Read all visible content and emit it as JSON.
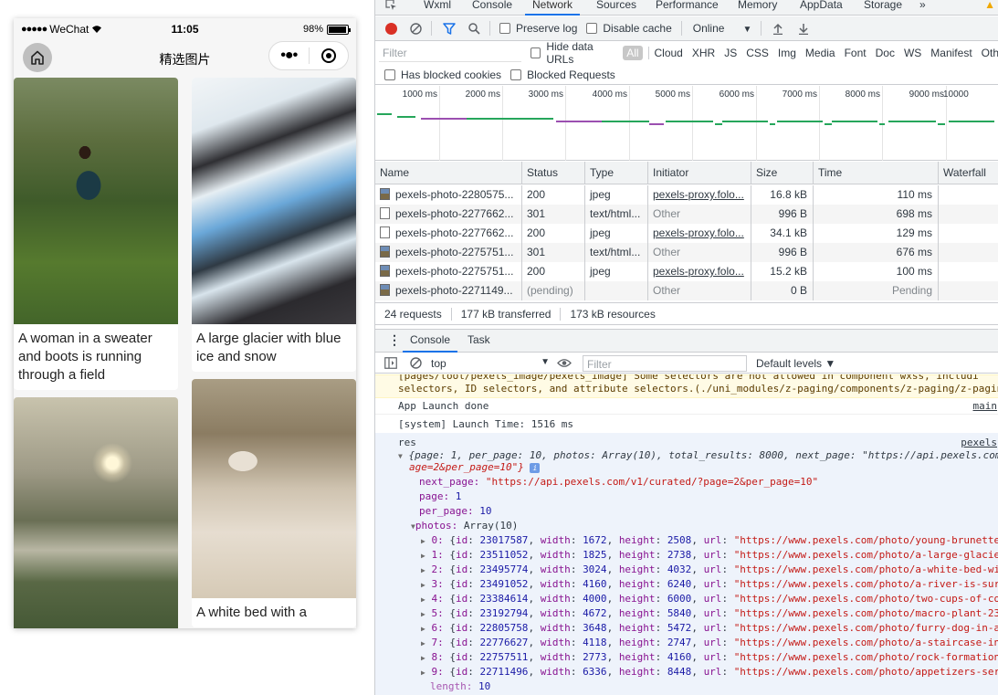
{
  "phone": {
    "status": {
      "carrier": "WeChat",
      "time": "11:05",
      "battery_text": "98%",
      "battery_level": 0.98
    },
    "nav": {
      "title": "精选图片"
    },
    "cards": [
      {
        "caption": "A woman in a sweater and boots is running through a field"
      },
      {
        "caption": "A large glacier with blue ice and snow"
      },
      {
        "caption": ""
      },
      {
        "caption": "A white bed with a"
      }
    ]
  },
  "devtools": {
    "tabs": [
      "Wxml",
      "Console",
      "Network",
      "Sources",
      "Performance",
      "Memory",
      "AppData",
      "Storage"
    ],
    "active_tab": "Network",
    "more": "»",
    "toolbar": {
      "preserve_log": "Preserve log",
      "disable_cache": "Disable cache",
      "throttle": "Online"
    },
    "filter": {
      "placeholder": "Filter",
      "hide_data_urls": "Hide data URLs",
      "types": [
        "All",
        "Cloud",
        "XHR",
        "JS",
        "CSS",
        "Img",
        "Media",
        "Font",
        "Doc",
        "WS",
        "Manifest",
        "Oth"
      ],
      "has_blocked_cookies": "Has blocked cookies",
      "blocked_requests": "Blocked Requests"
    },
    "timeline_labels": [
      "1000 ms",
      "2000 ms",
      "3000 ms",
      "4000 ms",
      "5000 ms",
      "6000 ms",
      "7000 ms",
      "8000 ms",
      "9000 ms",
      "10000"
    ],
    "columns": [
      "Name",
      "Status",
      "Type",
      "Initiator",
      "Size",
      "Time",
      "Waterfall"
    ],
    "rows": [
      {
        "name": "pexels-photo-2280575...",
        "status": "200",
        "type": "jpeg",
        "initiator": "pexels-proxy.folo...",
        "size": "16.8 kB",
        "time": "110 ms",
        "icon": "image"
      },
      {
        "name": "pexels-photo-2277662...",
        "status": "301",
        "type": "text/html...",
        "initiator": "Other",
        "size": "996 B",
        "time": "698 ms",
        "icon": "doc"
      },
      {
        "name": "pexels-photo-2277662...",
        "status": "200",
        "type": "jpeg",
        "initiator": "pexels-proxy.folo...",
        "size": "34.1 kB",
        "time": "129 ms",
        "icon": "doc"
      },
      {
        "name": "pexels-photo-2275751...",
        "status": "301",
        "type": "text/html...",
        "initiator": "Other",
        "size": "996 B",
        "time": "676 ms",
        "icon": "image"
      },
      {
        "name": "pexels-photo-2275751...",
        "status": "200",
        "type": "jpeg",
        "initiator": "pexels-proxy.folo...",
        "size": "15.2 kB",
        "time": "100 ms",
        "icon": "image"
      },
      {
        "name": "pexels-photo-2271149...",
        "status": "(pending)",
        "type": "",
        "initiator": "Other",
        "size": "0 B",
        "time": "Pending",
        "icon": "image"
      }
    ],
    "summary": {
      "requests": "24 requests",
      "transferred": "177 kB transferred",
      "resources": "173 kB resources"
    },
    "drawer": {
      "tabs": [
        "Console",
        "Task"
      ],
      "context": "top",
      "filter_placeholder": "Filter",
      "levels": "Default levels ▼"
    },
    "console": {
      "warning_line1": "[pages/tool/pexels_image/pexels_image] Some selectors are not allowed in component wxss, includi",
      "warning_line2": "selectors, ID selectors, and attribute selectors.(./uni_modules/z-paging/components/z-paging/z-pagin",
      "app_launch": "App Launch done",
      "app_launch_src": "main",
      "launch_time": "[system] Launch Time: 1516 ms",
      "res_label": "res",
      "res_src": "pexels",
      "summary_line1": "{page: 1, per_page: 10, photos: Array(10), total_results: 8000, next_page: \"https://api.pexels.com",
      "summary_line2": "age=2&per_page=10\"}",
      "next_page_key": "next_page:",
      "next_page_val": "\"https://api.pexels.com/v1/curated/?page=2&per_page=10\"",
      "page_key": "page:",
      "page_val": "1",
      "per_page_key": "per_page:",
      "per_page_val": "10",
      "photos_key": "photos:",
      "photos_val": "Array(10)",
      "photos": [
        {
          "idx": "0:",
          "id": "23017587",
          "width": "1672",
          "height": "2508",
          "url": "\"https://www.pexels.com/photo/young-brunette-"
        },
        {
          "idx": "1:",
          "id": "23511052",
          "width": "1825",
          "height": "2738",
          "url": "\"https://www.pexels.com/photo/a-large-glacier"
        },
        {
          "idx": "2:",
          "id": "23495774",
          "width": "3024",
          "height": "4032",
          "url": "\"https://www.pexels.com/photo/a-white-bed-wit"
        },
        {
          "idx": "3:",
          "id": "23491052",
          "width": "4160",
          "height": "6240",
          "url": "\"https://www.pexels.com/photo/a-river-is-surr"
        },
        {
          "idx": "4:",
          "id": "23384614",
          "width": "4000",
          "height": "6000",
          "url": "\"https://www.pexels.com/photo/two-cups-of-cof"
        },
        {
          "idx": "5:",
          "id": "23192794",
          "width": "4672",
          "height": "5840",
          "url": "\"https://www.pexels.com/photo/macro-plant-23"
        },
        {
          "idx": "6:",
          "id": "22805758",
          "width": "3648",
          "height": "5472",
          "url": "\"https://www.pexels.com/photo/furry-dog-in-a-"
        },
        {
          "idx": "7:",
          "id": "22776627",
          "width": "4118",
          "height": "2747",
          "url": "\"https://www.pexels.com/photo/a-staircase-in-"
        },
        {
          "idx": "8:",
          "id": "22757511",
          "width": "2773",
          "height": "4160",
          "url": "\"https://www.pexels.com/photo/rock-formation"
        },
        {
          "idx": "9:",
          "id": "22711496",
          "width": "6336",
          "height": "8448",
          "url": "\"https://www.pexels.com/photo/appetizers-serv"
        }
      ],
      "length_key": "length:",
      "length_val": "10"
    }
  }
}
